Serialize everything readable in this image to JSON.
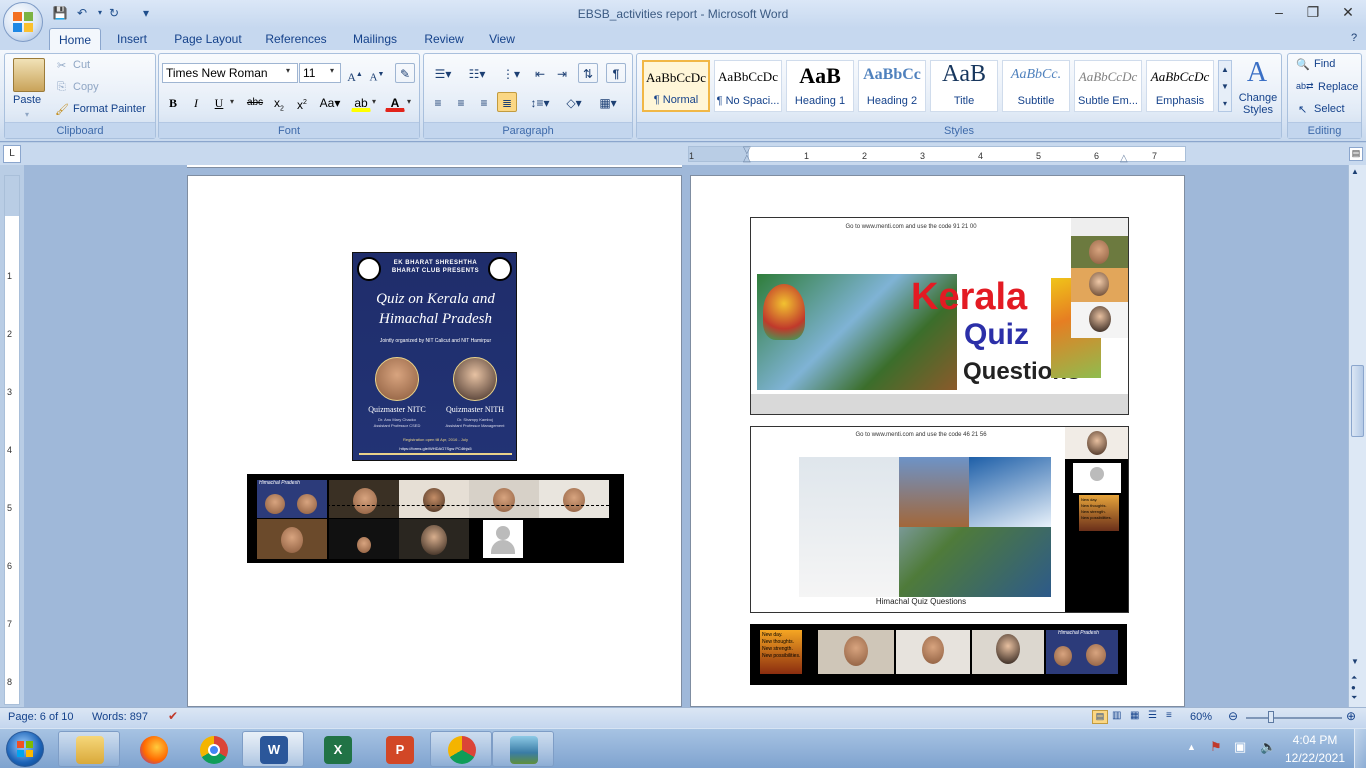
{
  "window": {
    "title": "EBSB_activities report - Microsoft Word"
  },
  "tabs": [
    {
      "label": "Home"
    },
    {
      "label": "Insert"
    },
    {
      "label": "Page Layout"
    },
    {
      "label": "References"
    },
    {
      "label": "Mailings"
    },
    {
      "label": "Review"
    },
    {
      "label": "View"
    }
  ],
  "clipboard": {
    "paste": "Paste",
    "cut": "Cut",
    "copy": "Copy",
    "format_painter": "Format Painter",
    "label": "Clipboard"
  },
  "font": {
    "name": "Times New Roman",
    "size": "11",
    "label": "Font"
  },
  "paragraph": {
    "label": "Paragraph"
  },
  "styles": {
    "label": "Styles",
    "items": [
      {
        "sample": "AaBbCcDc",
        "name": "¶ Normal"
      },
      {
        "sample": "AaBbCcDc",
        "name": "¶ No Spaci..."
      },
      {
        "sample": "AaB",
        "name": "Heading 1"
      },
      {
        "sample": "AaBbCc",
        "name": "Heading 2"
      },
      {
        "sample": "AaB",
        "name": "Title"
      },
      {
        "sample": "AaBbCc.",
        "name": "Subtitle"
      },
      {
        "sample": "AaBbCcDc",
        "name": "Subtle Em..."
      },
      {
        "sample": "AaBbCcDc",
        "name": "Emphasis"
      }
    ],
    "change_styles": "Change Styles"
  },
  "editing": {
    "find": "Find",
    "replace": "Replace",
    "select": "Select",
    "label": "Editing"
  },
  "ruler": {
    "ticks": [
      "1",
      "1",
      "2",
      "3",
      "4",
      "5",
      "6",
      "7"
    ],
    "vticks": [
      "1",
      "2",
      "3",
      "4",
      "5",
      "6",
      "7",
      "8"
    ]
  },
  "page1": {
    "poster": {
      "header1": "EK BHARAT SHRESHTHA",
      "header2": "BHARAT CLUB PRESENTS",
      "title": "Quiz on Kerala and Himachal Pradesh",
      "organized": "Jointly organized by NIT Calicut and NIT Hamirpur",
      "qm1_title": "Quizmaster NITC",
      "qm1_name": "Dr. Anu Mary Chacko",
      "qm1_role": "Assistant Professor CSED",
      "qm2_title": "Quizmaster NITH",
      "qm2_name": "Dr. Shampy Kamboj",
      "qm2_role": "Assistant Professor Management",
      "registration": "Registration open till Apr, 2016 - July",
      "link": "https://forms.gle/WHDAG7Sgw PC4thjs5"
    },
    "zoom_strip": {
      "label": "Himachal Pradesh"
    }
  },
  "page2": {
    "slide1": {
      "menti": "Go to www.menti.com and use the code 91 21 00",
      "w1": "Kerala",
      "w2": "Quiz",
      "w3": "Questions"
    },
    "slide2": {
      "menti": "Go to www.menti.com and use the code 46 21 56",
      "caption": "Himachal Quiz Questions",
      "note1": "New day.",
      "note2": "New thoughts.",
      "note3": "New strength.",
      "note4": "New possibilities."
    },
    "strip": {
      "note1": "New day.",
      "note2": "New thoughts.",
      "note3": "New strength.",
      "note4": "New possibilities.",
      "label": "Himachal Pradesh"
    }
  },
  "status": {
    "page": "Page: 6 of 10",
    "words": "Words: 897",
    "zoom": "60%"
  },
  "taskbar": {
    "time": "4:04 PM",
    "date": "12/22/2021"
  }
}
